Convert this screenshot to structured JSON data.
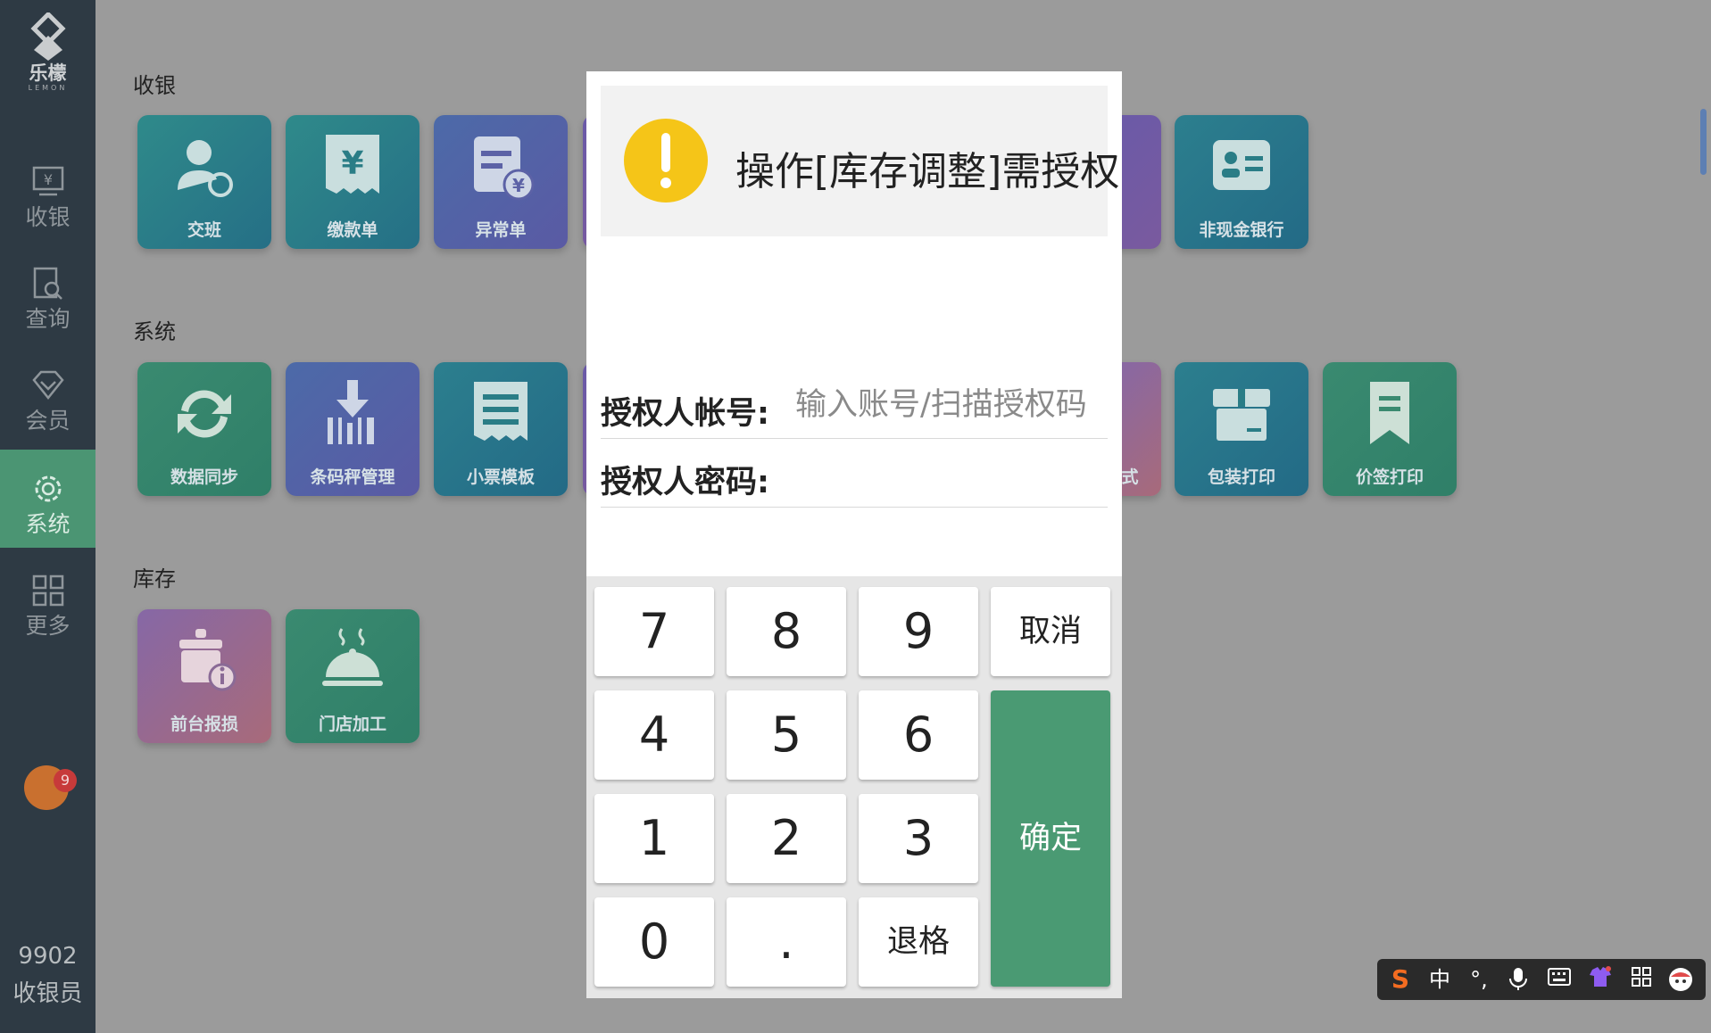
{
  "app": {
    "logo_name": "乐檬",
    "logo_sub": "LEMON"
  },
  "sidebar": {
    "items": [
      {
        "label": "收银",
        "icon": "cashier-icon"
      },
      {
        "label": "查询",
        "icon": "search-doc-icon"
      },
      {
        "label": "会员",
        "icon": "diamond-icon"
      },
      {
        "label": "系统",
        "icon": "gear-icon",
        "active": true
      },
      {
        "label": "更多",
        "icon": "grid-icon"
      }
    ],
    "notification_count": "9",
    "user_id": "9902",
    "user_role": "收银员"
  },
  "sections": [
    {
      "title": "收银",
      "tiles": [
        "交班",
        "缴款单",
        "异常单",
        "非现金银行"
      ]
    },
    {
      "title": "系统",
      "tiles": [
        "数据同步",
        "条码秤管理",
        "小票模板",
        "式",
        "包装打印",
        "价签打印"
      ]
    },
    {
      "title": "库存",
      "tiles": [
        "前台报损",
        "门店加工"
      ]
    }
  ],
  "modal": {
    "alert_text": "操作[库存调整]需授权",
    "account_label": "授权人帐号:",
    "account_placeholder": "输入账号/扫描授权码",
    "account_value": "",
    "password_label": "授权人密码:",
    "password_value": "",
    "keys": {
      "k7": "7",
      "k8": "8",
      "k9": "9",
      "cancel": "取消",
      "k4": "4",
      "k5": "5",
      "k6": "6",
      "k1": "1",
      "k2": "2",
      "k3": "3",
      "confirm": "确定",
      "k0": "0",
      "dot": ".",
      "backspace": "退格"
    }
  },
  "ime": {
    "mode": "中",
    "punct": "°,",
    "items": [
      "logo-icon",
      "mic-icon",
      "keyboard-icon",
      "shirt-icon",
      "apps-icon",
      "avatar-icon"
    ]
  },
  "colors": {
    "sidebar_bg": "#2e3a44",
    "active_green": "#4b9573",
    "confirm_green": "#4a9a73",
    "alert_yellow": "#f5c518",
    "overlay_gray": "#9b9b9b"
  }
}
